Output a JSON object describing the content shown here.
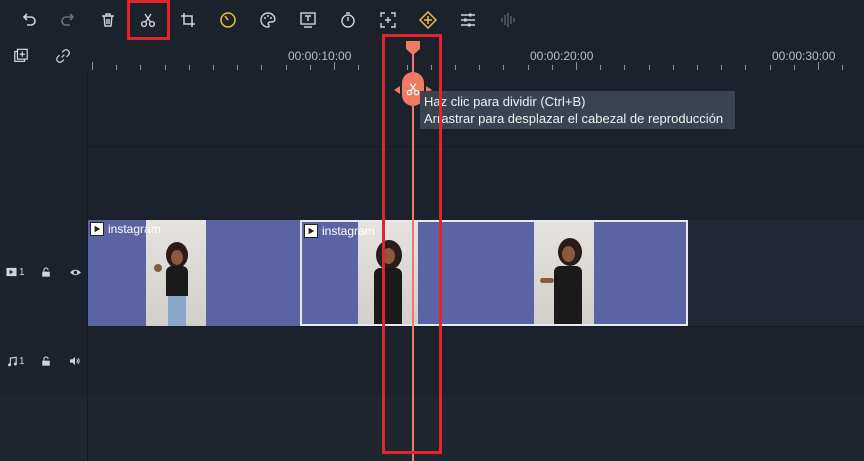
{
  "toolbar": {
    "items": [
      {
        "name": "undo-icon"
      },
      {
        "name": "redo-icon"
      },
      {
        "name": "delete-icon"
      },
      {
        "name": "scissors-icon"
      },
      {
        "name": "crop-icon"
      },
      {
        "name": "speed-icon"
      },
      {
        "name": "palette-icon"
      },
      {
        "name": "text-edit-icon"
      },
      {
        "name": "timer-icon"
      },
      {
        "name": "fit-screen-icon"
      },
      {
        "name": "keyframe-icon"
      },
      {
        "name": "adjust-icon"
      },
      {
        "name": "audio-wave-icon"
      }
    ],
    "accent": "#e8c23a"
  },
  "ruler": {
    "labels": [
      "00:00:10:00",
      "00:00:20:00",
      "00:00:30:00"
    ]
  },
  "tooltip": {
    "line1": "Haz clic para dividir (Ctrl+B)",
    "line2": "Arrastrar para desplazar el cabezal de reproducción"
  },
  "tracks": {
    "video": {
      "index": "1",
      "icon": "video-track-icon"
    },
    "audio": {
      "index": "1",
      "icon": "music-note-icon"
    }
  },
  "clips": [
    {
      "title": "instagram"
    },
    {
      "title": "instagram"
    }
  ],
  "colors": {
    "playhead": "#f07a64",
    "clip": "#5a64a4",
    "highlight": "#e0262b"
  }
}
